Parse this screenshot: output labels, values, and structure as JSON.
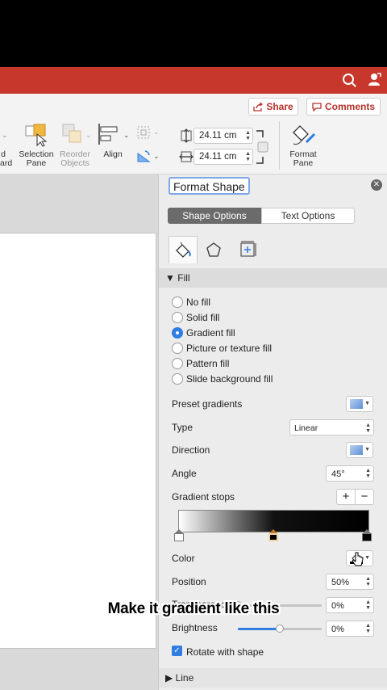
{
  "header": {
    "share_label": "Share",
    "comments_label": "Comments"
  },
  "ribbon": {
    "partial_label": "d",
    "partial_label2": "ard",
    "selection_pane_line1": "Selection",
    "selection_pane_line2": "Pane",
    "reorder_line1": "Reorder",
    "reorder_line2": "Objects",
    "align_label": "Align",
    "height_value": "24.11 cm",
    "width_value": "24.11 cm",
    "format_pane_line1": "Format",
    "format_pane_line2": "Pane"
  },
  "pane": {
    "title": "Format Shape",
    "tabs": [
      "Shape Options",
      "Text Options"
    ],
    "fill_header": "Fill",
    "fill_options": [
      "No fill",
      "Solid fill",
      "Gradient fill",
      "Picture or texture fill",
      "Pattern fill",
      "Slide background fill"
    ],
    "selected_fill": "Gradient fill",
    "preset_gradients_label": "Preset gradients",
    "type_label": "Type",
    "type_value": "Linear",
    "direction_label": "Direction",
    "angle_label": "Angle",
    "angle_value": "45°",
    "gradient_stops_label": "Gradient stops",
    "add_stop": "+",
    "remove_stop": "−",
    "color_label": "Color",
    "position_label": "Position",
    "position_value": "50%",
    "transparency_label": "Transparency",
    "transparency_value": "0%",
    "transparency_level": 0,
    "brightness_label": "Brightness",
    "brightness_value": "0%",
    "brightness_level": 0.5,
    "rotate_label": "Rotate with shape",
    "rotate_checked": true,
    "line_header": "Line"
  },
  "caption": "Make it gradient like this",
  "colors": {
    "title_bar": "#c8372c",
    "accent_blue": "#2f7de1"
  }
}
